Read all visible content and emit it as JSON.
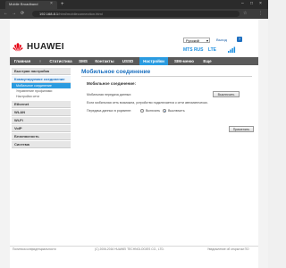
{
  "browser": {
    "tab_title": "Mobile Broadband",
    "url_host": "192.168.8.1",
    "url_path": "/html/mobileconnection.html",
    "close_glyph": "×",
    "new_tab_glyph": "+",
    "nav_back": "←",
    "nav_forward": "→",
    "nav_reload": "⟳",
    "minimize_glyph": "–",
    "maximize_glyph": "□",
    "window_close_glyph": "×",
    "star_glyph": "☆",
    "menu_glyph": "⋮"
  },
  "header": {
    "brand": "HUAWEI",
    "language": "Русский",
    "language_arrow": "▾",
    "logout": "Выход",
    "help": "?",
    "operator": "MTS RUS",
    "network": "LTE",
    "signal_icon": "signal-bars-icon"
  },
  "topnav": {
    "items": [
      {
        "label": "Главная"
      },
      {
        "label": "↑"
      },
      {
        "label": "Статистика"
      },
      {
        "label": "SMS"
      },
      {
        "label": "Контакты"
      },
      {
        "label": "USSD"
      },
      {
        "label": "Настройки"
      },
      {
        "label": "SIM-меню"
      },
      {
        "label": "Еще"
      }
    ],
    "active_index": 6
  },
  "sidebar": {
    "quick_setup": "Быстрая настройка",
    "dialup": "Коммутируемое соединение",
    "dialup_items": [
      "Мобильное соединение",
      "Управление профилями",
      "Настройки сети"
    ],
    "ethernet": "Ethernet",
    "wlan": "WLAN",
    "wifi": "Wi-Fi",
    "voip": "VoIP",
    "security": "Безопасность",
    "system": "Система"
  },
  "content": {
    "title": "Мобильное соединение",
    "section_title": "Мобильное соединение:",
    "mobile_data_label": "Мобильная передача данных:",
    "off_button": "Выключить",
    "info_text": "Если мобильная сеть возможна, устройство подключается к сети автоматически.",
    "roaming_label": "Передача данных в роуминге:",
    "roaming_options": [
      "Включить",
      "Выключить"
    ],
    "roaming_selected": 1,
    "apply_button": "Применить"
  },
  "footer": {
    "privacy": "Политика конфиденциальности",
    "copyright": "(C) 2006-2016 HUAWEI TECHNOLOGIES CO., LTD.",
    "opensource": "Уведомление об открытом ПО"
  },
  "colors": {
    "accent": "#2a9be0",
    "brand_red": "#e60012",
    "nav_bg": "#5a5a5a"
  }
}
